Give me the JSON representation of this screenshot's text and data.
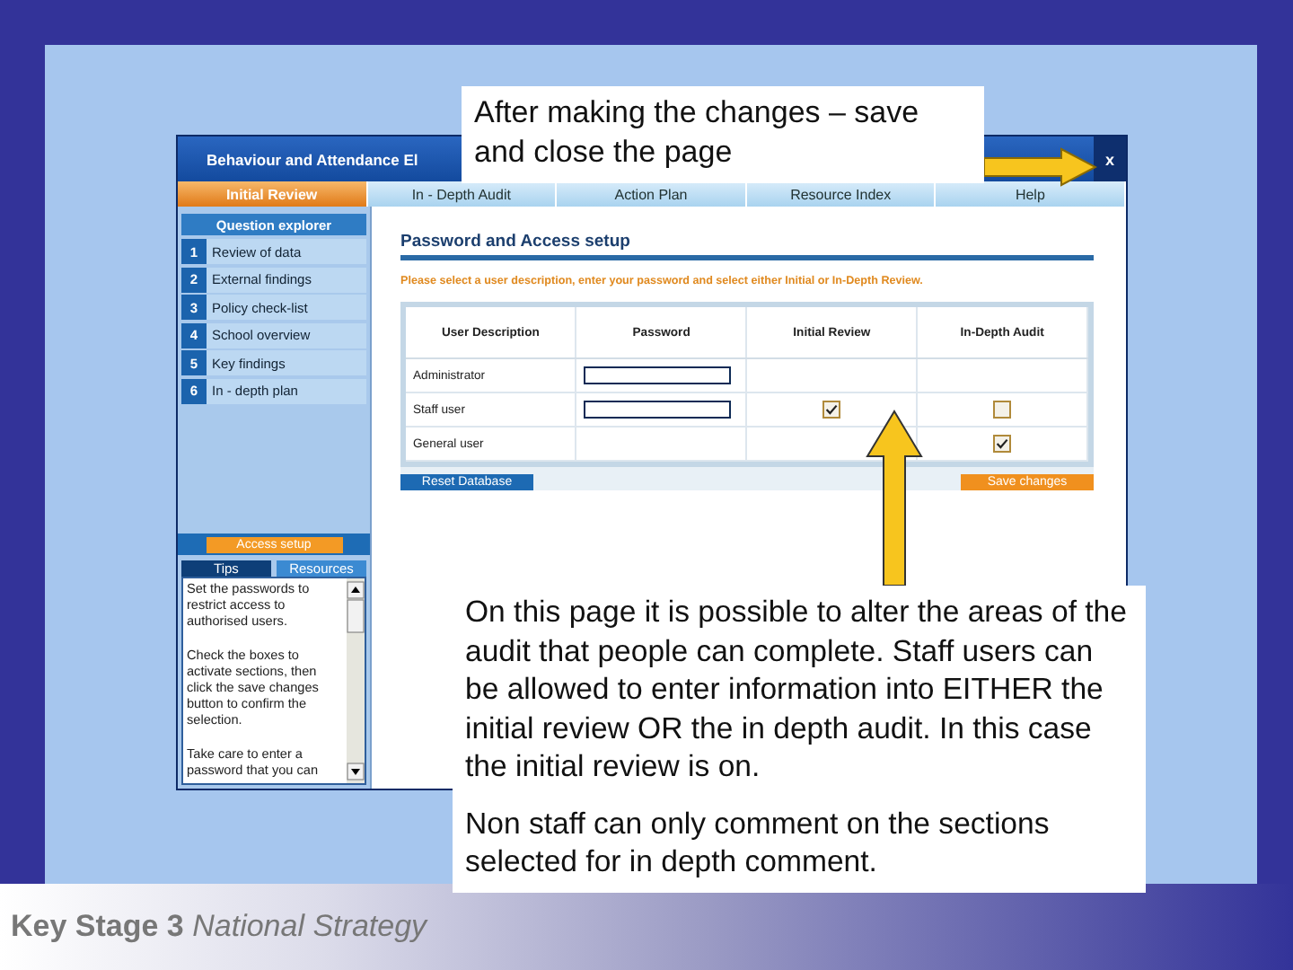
{
  "window": {
    "title": "Behaviour and Attendance El",
    "close_label": "x"
  },
  "nav_tabs": [
    {
      "label": "Initial Review",
      "selected": true
    },
    {
      "label": "In - Depth Audit",
      "selected": false
    },
    {
      "label": "Action Plan",
      "selected": false
    },
    {
      "label": "Resource Index",
      "selected": false
    },
    {
      "label": "Help",
      "selected": false
    }
  ],
  "sidebar": {
    "header": "Question explorer",
    "items": [
      {
        "number": "1",
        "label": "Review of data"
      },
      {
        "number": "2",
        "label": "External findings"
      },
      {
        "number": "3",
        "label": "Policy check-list"
      },
      {
        "number": "4",
        "label": "School overview"
      },
      {
        "number": "5",
        "label": "Key findings"
      },
      {
        "number": "6",
        "label": "In - depth plan"
      }
    ],
    "access_button": "Access setup",
    "help_tabs": [
      {
        "label": "Tips",
        "selected": true
      },
      {
        "label": "Resources",
        "selected": false
      }
    ],
    "tips": [
      "Set the passwords to restrict access to authorised users.",
      "Check the boxes to activate sections, then click the save changes button to confirm the selection.",
      "Take care to enter a password that you can"
    ]
  },
  "content": {
    "heading": "Password and Access setup",
    "instruction": "Please select a user description, enter your password and select either Initial or In-Depth Review.",
    "table": {
      "columns": [
        "User Description",
        "Password",
        "Initial Review",
        "In-Depth Audit"
      ],
      "rows": [
        {
          "cells": [
            {
              "kind": "text",
              "text": "Administrator"
            },
            {
              "kind": "field"
            },
            {
              "kind": "empty"
            },
            {
              "kind": "empty"
            }
          ]
        },
        {
          "cells": [
            {
              "kind": "text",
              "text": "Staff user"
            },
            {
              "kind": "field"
            },
            {
              "kind": "checkbox",
              "checked": true
            },
            {
              "kind": "checkbox",
              "checked": false
            }
          ]
        },
        {
          "cells": [
            {
              "kind": "text",
              "text": "General user"
            },
            {
              "kind": "empty"
            },
            {
              "kind": "empty"
            },
            {
              "kind": "checkbox",
              "checked": true
            }
          ]
        }
      ]
    },
    "buttons": [
      {
        "label": "Reset Database",
        "kind": "secondary"
      },
      {
        "label": "Save changes",
        "kind": "primary"
      }
    ]
  },
  "callouts": [
    {
      "paragraphs": [
        "After making the changes – save and close the page"
      ]
    },
    {
      "paragraphs": [
        "On this page it is possible to alter the areas of the audit that people can complete. Staff users can be allowed to enter information into EITHER the initial review OR the in depth audit. In this case the initial review is on.",
        "Non staff can only comment on the sections selected for in depth comment."
      ]
    }
  ],
  "footer": {
    "text": "**Key Stage 3** *National Strategy*"
  }
}
